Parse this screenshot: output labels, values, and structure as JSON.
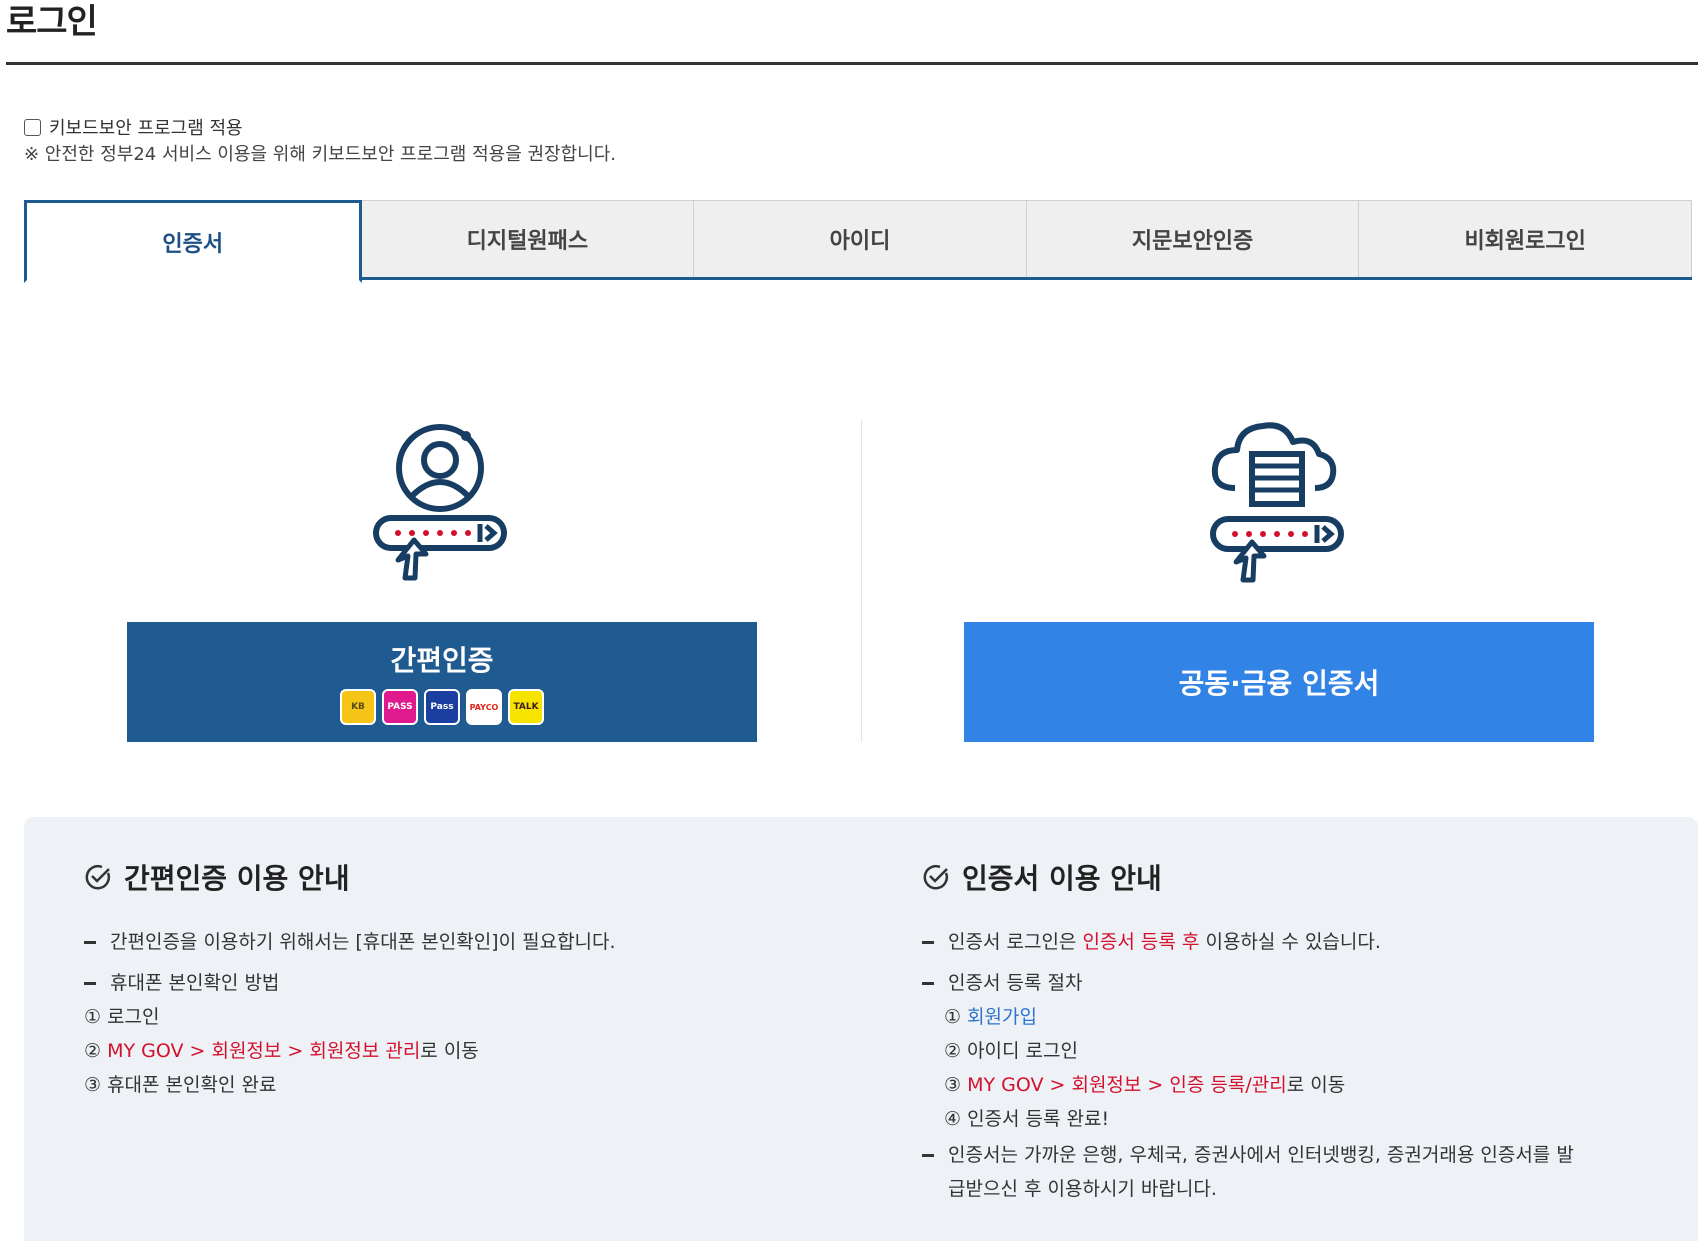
{
  "page": {
    "title": "로그인"
  },
  "keyboard_security": {
    "checkbox_label": "키보드보안 프로그램 적용",
    "notice": "※ 안전한 정부24 서비스 이용을 위해 키보드보안 프로그램 적용을 권장합니다."
  },
  "tabs": [
    {
      "label": "인증서",
      "active": true
    },
    {
      "label": "디지털원패스",
      "active": false
    },
    {
      "label": "아이디",
      "active": false
    },
    {
      "label": "지문보안인증",
      "active": false
    },
    {
      "label": "비회원로그인",
      "active": false
    }
  ],
  "login_options": {
    "easy_auth": {
      "label": "간편인증",
      "providers": [
        "KB",
        "PASS",
        "Pass",
        "PAYCO",
        "TALK"
      ]
    },
    "cert": {
      "label": "공동·금융 인증서"
    }
  },
  "guide": {
    "easy": {
      "heading": "간편인증 이용 안내",
      "item1": "간편인증을 이용하기 위해서는 [휴대폰 본인확인]이 필요합니다.",
      "item2": "휴대폰 본인확인 방법",
      "step1": "① 로그인",
      "step2_prefix": "② ",
      "step2_red": "MY GOV > 회원정보 > 회원정보 관리",
      "step2_suffix": "로 이동",
      "step3": "③ 휴대폰 본인확인 완료"
    },
    "cert": {
      "heading": "인증서 이용 안내",
      "item1_prefix": "인증서 로그인은 ",
      "item1_red": "인증서 등록 후",
      "item1_suffix": " 이용하실 수 있습니다.",
      "item2": "인증서 등록 절차",
      "step1_prefix": "① ",
      "step1_link": "회원가입",
      "step2": "② 아이디 로그인",
      "step3_prefix": "③ ",
      "step3_red": "MY GOV > 회원정보 > 인증 등록/관리",
      "step3_suffix": "로 이동",
      "step4": "④ 인증서 등록 완료!",
      "item3": "인증서는 가까운 은행, 우체국, 증권사에서 인터넷뱅킹, 증권거래용 인증서를 발급받으신 후 이용하시기 바랍니다."
    }
  },
  "colors": {
    "primary_dark": "#1f5a91",
    "primary_light": "#3283e6",
    "accent_red": "#d3112d"
  }
}
